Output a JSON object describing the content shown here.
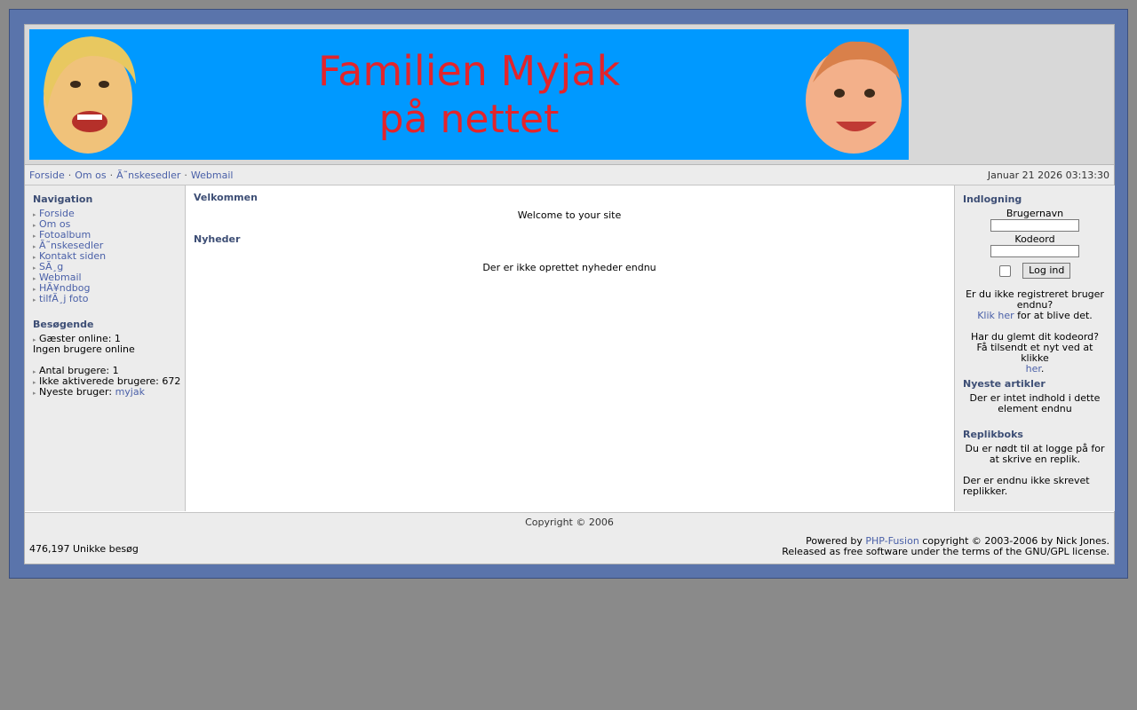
{
  "banner": {
    "line1": "Familien Myjak",
    "line2": "på nettet"
  },
  "topnav": {
    "links": [
      "Forside",
      "Om os",
      "Ã˜nskesedler",
      "Webmail"
    ],
    "separator": "·",
    "datetime": "Januar 21 2026 03:13:30"
  },
  "navigation": {
    "title": "Navigation",
    "items": [
      "Forside",
      "Om os",
      "Fotoalbum",
      "Ã˜nskesedler",
      "Kontakt siden",
      "SÃ¸g",
      "Webmail",
      "HÃ¥ndbog",
      "tilfÃ¸j foto"
    ]
  },
  "visitors": {
    "title": "Besøgende",
    "guests_online": "Gæster online: 1",
    "no_users": "Ingen brugere online",
    "user_count": "Antal brugere: 1",
    "inactive": "Ikke aktiverede brugere: 672",
    "newest_label": "Nyeste bruger:",
    "newest_user": "myjak"
  },
  "main": {
    "welcome_title": "Velkommen",
    "welcome_text": "Welcome to your site",
    "news_title": "Nyheder",
    "news_empty": "Der er ikke oprettet nyheder endnu"
  },
  "login": {
    "title": "Indlogning",
    "username_label": "Brugernavn",
    "password_label": "Kodeord",
    "button": "Log ind",
    "not_registered": "Er du ikke registreret bruger endnu?",
    "click_here": "Klik her",
    "become_one": "for at blive det.",
    "forgot": "Har du glemt dit kodeord?",
    "send_new": "Få tilsendt et nyt ved at klikke",
    "here": "her",
    "period": "."
  },
  "articles": {
    "title": "Nyeste artikler",
    "empty": "Der er intet indhold i dette element endnu"
  },
  "shoutbox": {
    "title": "Replikboks",
    "must_login": "Du er nødt til at logge på for at skrive en replik.",
    "empty": "Der er endnu ikke skrevet replikker."
  },
  "footer": {
    "copyright": "Copyright © 2006",
    "visits": "476,197 Unikke besøg",
    "powered_by": "Powered by",
    "phpfusion": "PHP-Fusion",
    "copyright_text": "copyright © 2003-2006 by Nick Jones.",
    "license": "Released as free software under the terms of the GNU/GPL license."
  },
  "colors": {
    "banner_bg": "#0099ff",
    "banner_text": "#e3242b",
    "outer_frame": "#5a74ab",
    "link": "#4a60a8",
    "caption": "#3d4e75"
  }
}
